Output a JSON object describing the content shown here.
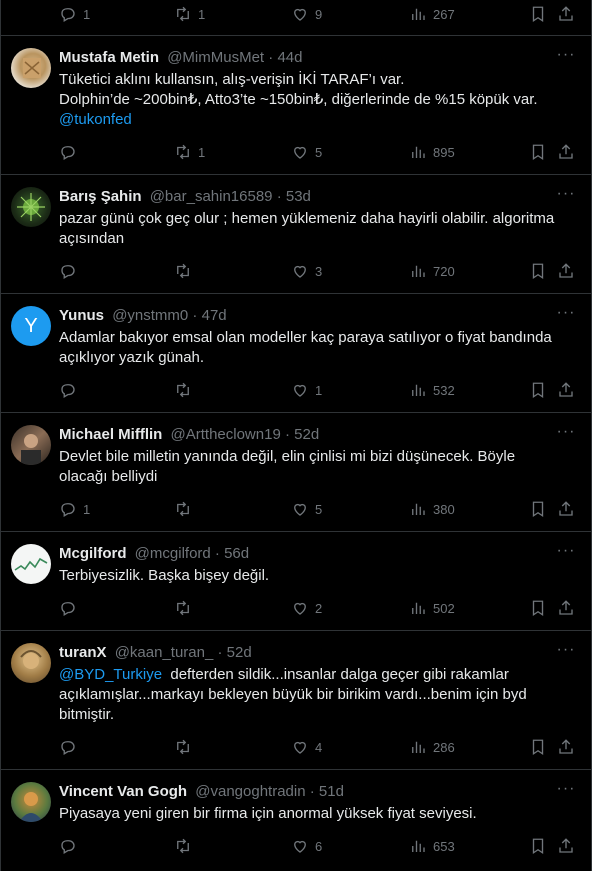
{
  "top_bar": {
    "replies": "1",
    "retweets": "1",
    "likes": "9",
    "views": "267"
  },
  "tweets": [
    {
      "name": "Mustafa Metin",
      "handle": "@MimMusMet",
      "time": "44d",
      "lines": [
        "Tüketici aklını kullansın, alış-verişin İKİ TARAF’ı var.",
        "Dolphin’de ~200bin₺, Atto3’te ~150bin₺, diğerlerinde de %15 köpük var."
      ],
      "mention": "@tukonfed",
      "replies": "",
      "retweets": "1",
      "likes": "5",
      "views": "895"
    },
    {
      "name": "Barış Şahin",
      "handle": "@bar_sahin16589",
      "time": "53d",
      "lines": [
        "pazar günü çok geç olur ; hemen yüklemeniz daha hayirli olabilir. algoritma",
        "açısından"
      ],
      "replies": "",
      "retweets": "",
      "likes": "3",
      "views": "720"
    },
    {
      "name": "Yunus",
      "handle": "@ynstmm0",
      "time": "47d",
      "avatar_letter": "Y",
      "lines": [
        "Adamlar bakıyor emsal olan modeller kaç paraya satılıyor o fiyat bandında",
        "açıklıyor yazık günah."
      ],
      "replies": "",
      "retweets": "",
      "likes": "1",
      "views": "532"
    },
    {
      "name": "Michael Mifflin",
      "handle": "@Arttheclown19",
      "time": "52d",
      "lines": [
        "Devlet bile milletin yanında değil, elin çinlisi mi bizi düşünecek. Böyle",
        "olacağı belliydi"
      ],
      "replies": "1",
      "retweets": "",
      "likes": "5",
      "views": "380"
    },
    {
      "name": "Mcgilford",
      "handle": "@mcgilford",
      "time": "56d",
      "lines": [
        "Terbiyesizlik. Başka bişey değil."
      ],
      "replies": "",
      "retweets": "",
      "likes": "2",
      "views": "502"
    },
    {
      "name": "turanX",
      "handle": "@kaan_turan_",
      "time": "52d",
      "mention_lead": "@BYD_Turkiye",
      "lines": [
        "  defterden sildik...insanlar dalga geçer gibi rakamlar",
        "açıklamışlar...markayı bekleyen büyük bir birikim vardı...benim için byd",
        "bitmiştir."
      ],
      "replies": "",
      "retweets": "",
      "likes": "4",
      "views": "286"
    },
    {
      "name": "Vincent Van Gogh",
      "handle": "@vangoghtradin",
      "time": "51d",
      "lines": [
        "Piyasaya yeni giren bir firma için anormal yüksek fiyat seviyesi."
      ],
      "replies": "",
      "retweets": "",
      "likes": "6",
      "views": "653"
    }
  ],
  "colors": {
    "background": "#000000",
    "text": "#e7e9ea",
    "muted": "#71767b",
    "accent": "#1d9bf0",
    "border": "#2f3336"
  }
}
